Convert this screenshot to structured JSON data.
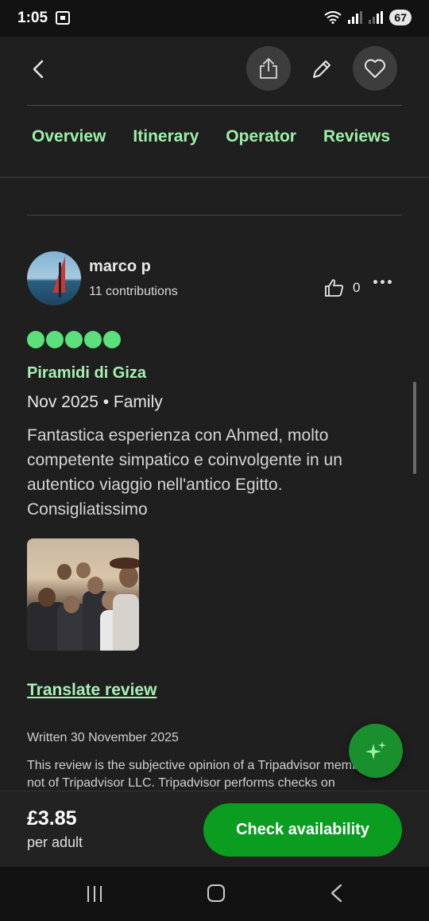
{
  "status": {
    "time": "1:05",
    "battery": "67"
  },
  "header": {
    "tabs": [
      {
        "label": "Overview"
      },
      {
        "label": "Itinerary"
      },
      {
        "label": "Operator"
      },
      {
        "label": "Reviews"
      }
    ]
  },
  "review": {
    "username": "marco p",
    "contributions": "11 contributions",
    "likes": "0",
    "rating": 5,
    "title": "Piramidi di Giza",
    "meta": "Nov 2025 • Family",
    "body": "Fantastica esperienza con Ahmed, molto competente simpatico e coinvolgente in un autentico viaggio nell'antico Egitto. Consigliatissimo",
    "translate_label": "Translate review",
    "written": "Written 30 November 2025",
    "disclaimer": "This review is the subjective opinion of a Tripadvisor member and not of Tripadvisor LLC. Tripadvisor performs checks on"
  },
  "booking": {
    "price": "£3.85",
    "per": "per adult",
    "cta_label": "Check availability"
  },
  "colors": {
    "accent_green": "#5be07b",
    "tab_text": "#9ef0a8",
    "cta_bg": "#0a9d1f"
  },
  "icons": [
    "back-arrow-icon",
    "share-icon",
    "edit-pencil-icon",
    "heart-icon",
    "thumbs-up-icon",
    "more-dots-icon",
    "sparkle-icon"
  ]
}
